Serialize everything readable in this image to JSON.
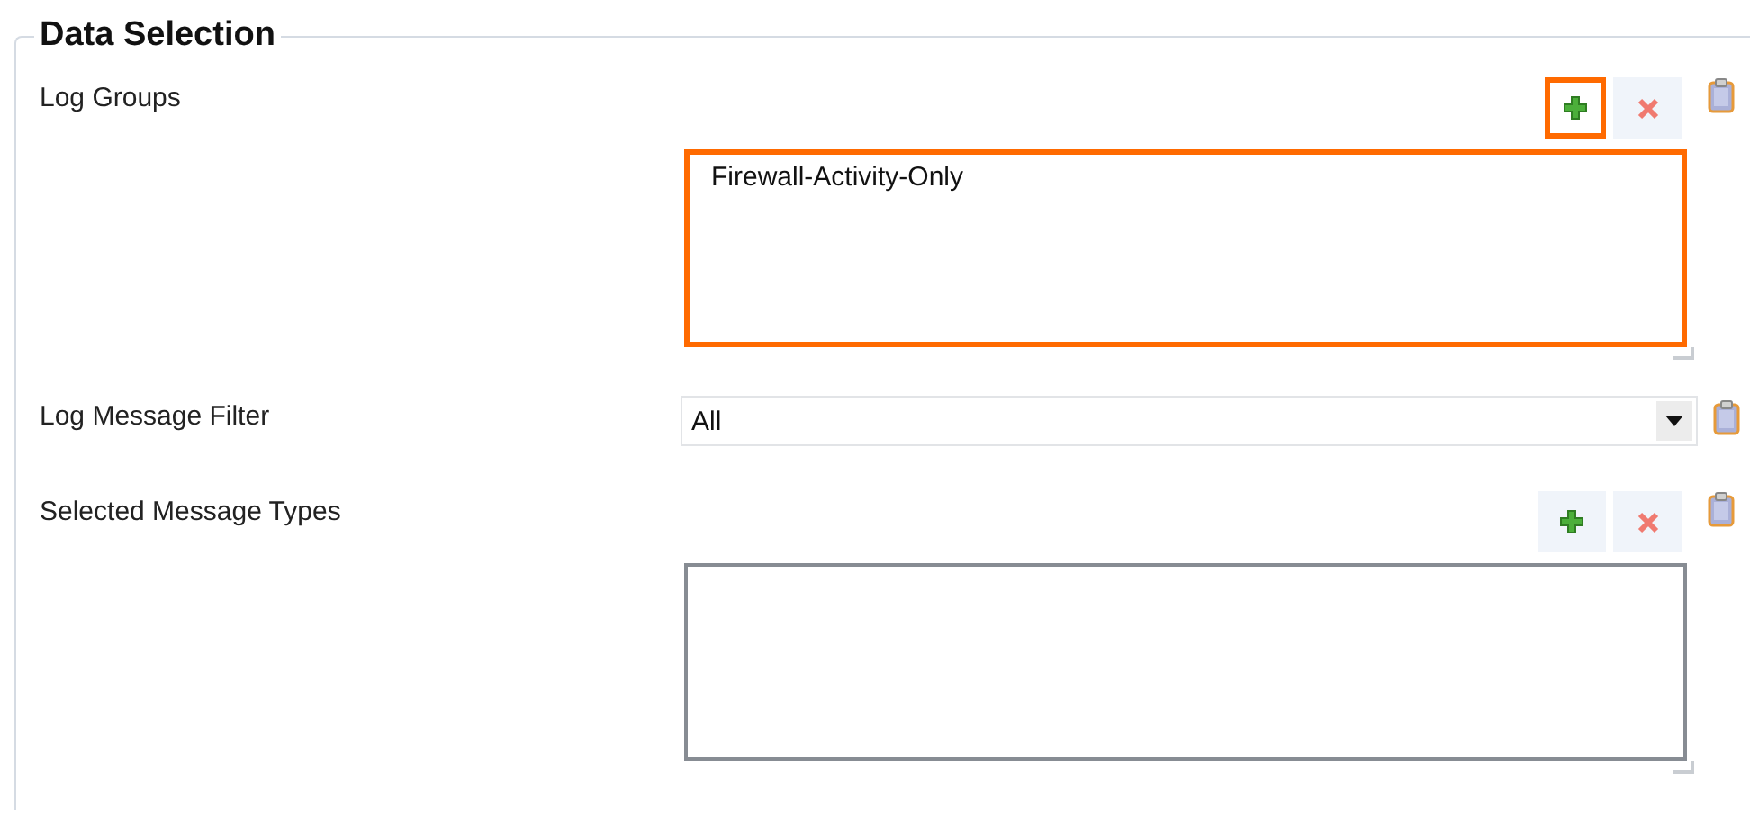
{
  "panel": {
    "title": "Data Selection"
  },
  "fields": [
    {
      "kind": "list",
      "label": "Log Groups",
      "add_highlighted": true,
      "highlighted": true,
      "items": [
        "Firewall-Activity-Only"
      ]
    },
    {
      "kind": "dropdown",
      "label": "Log Message Filter",
      "value": "All"
    },
    {
      "kind": "list",
      "label": "Selected Message Types",
      "add_highlighted": false,
      "highlighted": false
    }
  ]
}
